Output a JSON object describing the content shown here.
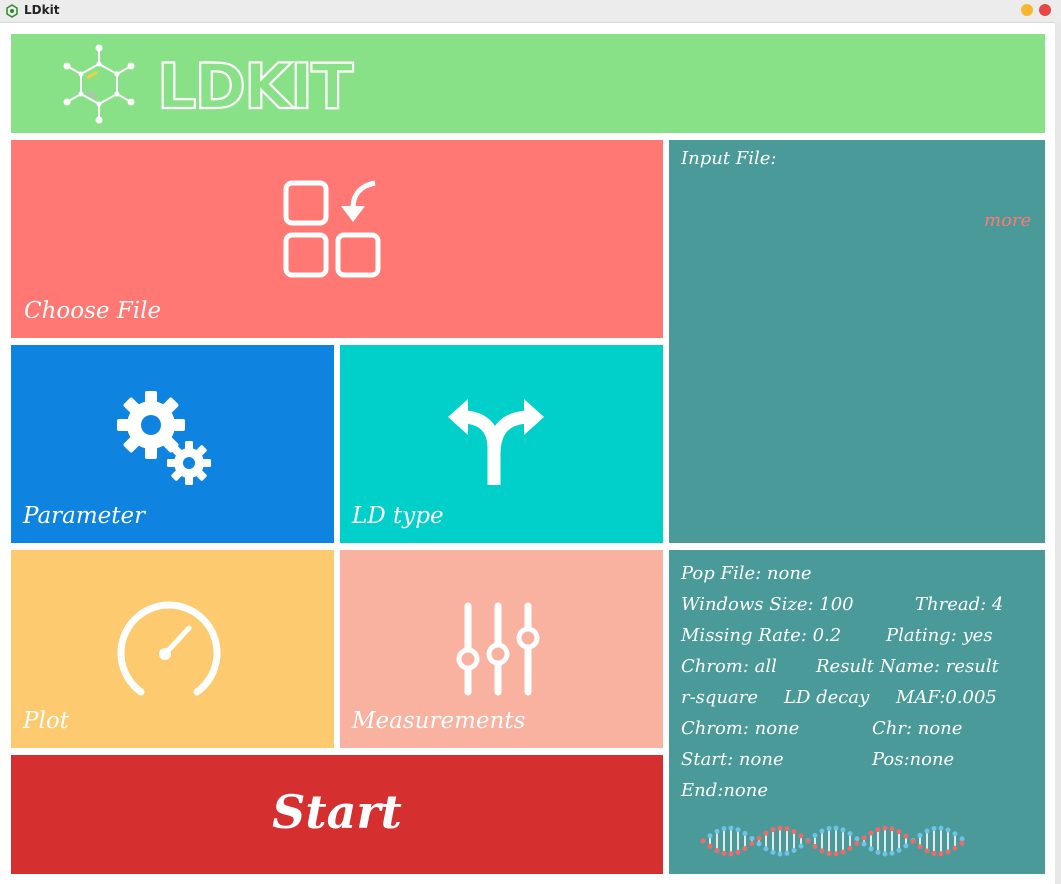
{
  "window": {
    "title": "LDkit"
  },
  "colors": {
    "header": "#88e087",
    "choose_file": "#ff7873",
    "parameter": "#0e84e0",
    "ld_type": "#00d0c9",
    "plot": "#fdca6f",
    "measurements": "#f9b1a0",
    "start": "#d62f2f",
    "panel": "#4a9a99",
    "more": "#ff7873"
  },
  "header": {
    "logo_icon": "molecule-icon",
    "logo_text": "LDKIT"
  },
  "tiles": {
    "choose_file": {
      "label": "Choose File",
      "icon": "apps-grid-arrow-icon"
    },
    "parameter": {
      "label": "Parameter",
      "icon": "gears-icon"
    },
    "ld_type": {
      "label": "LD type",
      "icon": "fork-arrow-icon"
    },
    "plot": {
      "label": "Plot",
      "icon": "gauge-icon"
    },
    "measurements": {
      "label": "Measurements",
      "icon": "sliders-icon"
    },
    "start": {
      "label": "Start"
    }
  },
  "input_panel": {
    "label": "Input File:",
    "more": "more"
  },
  "info": {
    "pop_file": "Pop File:  none",
    "windows_size": "Windows Size: 100",
    "thread": "Thread: 4",
    "missing_rate": "Missing Rate: 0.2",
    "plating": "Plating: yes",
    "chrom_all": "Chrom: all",
    "result_name": "Result Name: result",
    "r_square": "r-square",
    "ld_decay": "LD decay",
    "maf": "MAF:0.005",
    "chrom_none": "Chrom: none",
    "chr": "Chr: none",
    "start": "Start: none",
    "pos": "Pos:none",
    "end": "End:none",
    "dna_icon": "dna-strand-icon"
  }
}
